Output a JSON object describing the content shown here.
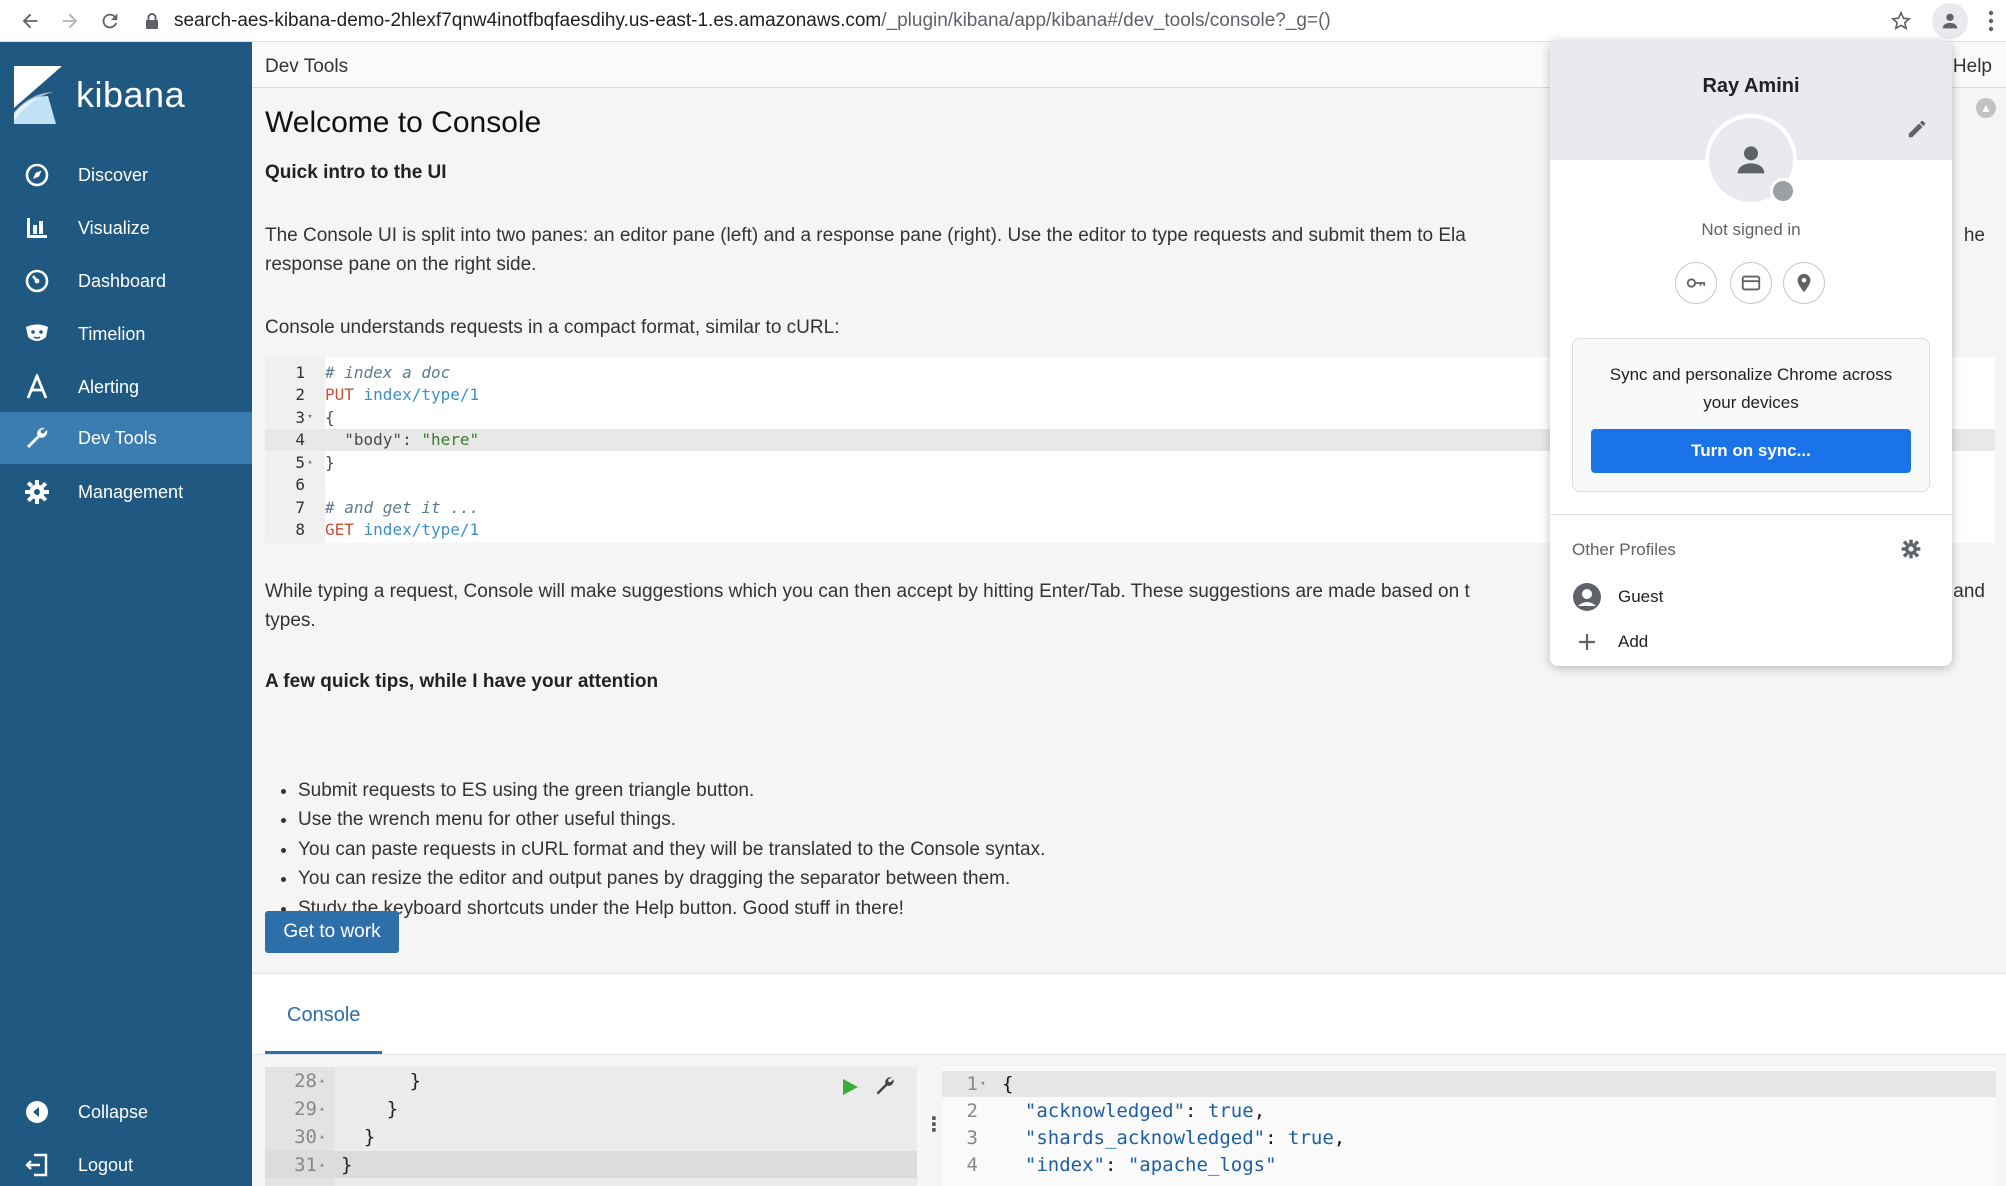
{
  "browser": {
    "url_domain": "search-aes-kibana-demo-2hlexf7qnw4inotfbqfaesdihy.us-east-1.es.amazonaws.com",
    "url_path": "/_plugin/kibana/app/kibana#/dev_tools/console?_g=()"
  },
  "sidebar": {
    "brand": "kibana",
    "items": [
      {
        "label": "Discover",
        "icon": "compass-icon"
      },
      {
        "label": "Visualize",
        "icon": "bar-chart-icon"
      },
      {
        "label": "Dashboard",
        "icon": "dashboard-icon"
      },
      {
        "label": "Timelion",
        "icon": "timelion-icon"
      },
      {
        "label": "Alerting",
        "icon": "alerting-icon"
      },
      {
        "label": "Dev Tools",
        "icon": "wrench-icon"
      },
      {
        "label": "Management",
        "icon": "gear-icon"
      }
    ],
    "collapse": "Collapse",
    "logout": "Logout"
  },
  "topbar": {
    "crumb": "Dev Tools",
    "help": "Help"
  },
  "welcome": {
    "title": "Welcome to Console",
    "intro_heading": "Quick intro to the UI",
    "intro_text": "The Console UI is split into two panes: an editor pane (left) and a response pane (right). Use the editor to type requests and submit them to Ela",
    "intro_text_tail": "he",
    "intro_text_line2": "response pane on the right side.",
    "curl_text": "Console understands requests in a compact format, similar to cURL:",
    "code_lines": [
      {
        "n": "1",
        "fold": "",
        "parts": [
          {
            "t": "# index a doc",
            "c": "c-comment"
          }
        ]
      },
      {
        "n": "2",
        "fold": "",
        "parts": [
          {
            "t": "PUT",
            "c": "c-method"
          },
          {
            "t": " index/type/1",
            "c": "c-url"
          }
        ]
      },
      {
        "n": "3",
        "fold": "▾",
        "parts": [
          {
            "t": "{",
            "c": "c-key"
          }
        ]
      },
      {
        "n": "4",
        "fold": "",
        "parts": [
          {
            "t": "  \"body\"",
            "c": "c-key"
          },
          {
            "t": ": ",
            "c": "c-key"
          },
          {
            "t": "\"here\"",
            "c": "c-str"
          }
        ]
      },
      {
        "n": "5",
        "fold": "▴",
        "parts": [
          {
            "t": "}",
            "c": "c-key"
          }
        ]
      },
      {
        "n": "6",
        "fold": "",
        "parts": []
      },
      {
        "n": "7",
        "fold": "",
        "parts": [
          {
            "t": "# and get it ...",
            "c": "c-comment"
          }
        ]
      },
      {
        "n": "8",
        "fold": "",
        "parts": [
          {
            "t": "GET",
            "c": "c-method"
          },
          {
            "t": " index/type/1",
            "c": "c-url"
          }
        ]
      }
    ],
    "suggest_text": "While typing a request, Console will make suggestions which you can then accept by hitting Enter/Tab. These suggestions are made based on t",
    "suggest_tail": "and",
    "suggest_line2": "types.",
    "tips_heading": "A few quick tips, while I have your attention",
    "tips": [
      "Submit requests to ES using the green triangle button.",
      "Use the wrench menu for other useful things.",
      "You can paste requests in cURL format and they will be translated to the Console syntax.",
      "You can resize the editor and output panes by dragging the separator between them.",
      "Study the keyboard shortcuts under the Help button. Good stuff in there!"
    ],
    "button": "Get to work"
  },
  "console": {
    "tab": "Console",
    "editor_lines": [
      {
        "n": "28",
        "fold": "▴",
        "code": "      }"
      },
      {
        "n": "29",
        "fold": "▴",
        "code": "    }"
      },
      {
        "n": "30",
        "fold": "▴",
        "code": "  }"
      },
      {
        "n": "31",
        "fold": "▴",
        "code": "}"
      }
    ],
    "output_lines": [
      {
        "n": "1",
        "fold": "▾",
        "parts": [
          {
            "t": "{",
            "c": ""
          }
        ]
      },
      {
        "n": "2",
        "fold": "",
        "parts": [
          {
            "t": "  \"acknowledged\"",
            "c": "o-key"
          },
          {
            "t": ": ",
            "c": ""
          },
          {
            "t": "true",
            "c": "o-bool"
          },
          {
            "t": ",",
            "c": ""
          }
        ]
      },
      {
        "n": "3",
        "fold": "",
        "parts": [
          {
            "t": "  \"shards_acknowledged\"",
            "c": "o-key"
          },
          {
            "t": ": ",
            "c": ""
          },
          {
            "t": "true",
            "c": "o-bool"
          },
          {
            "t": ",",
            "c": ""
          }
        ]
      },
      {
        "n": "4",
        "fold": "",
        "parts": [
          {
            "t": "  \"index\"",
            "c": "o-key"
          },
          {
            "t": ": ",
            "c": ""
          },
          {
            "t": "\"apache_logs\"",
            "c": "o-str"
          }
        ]
      }
    ]
  },
  "profile_popup": {
    "name": "Ray Amini",
    "status": "Not signed in",
    "sync_text_line1": "Sync and personalize Chrome across",
    "sync_text_line2": "your devices",
    "sync_button": "Turn on sync...",
    "other_profiles_label": "Other Profiles",
    "profiles": [
      {
        "label": "Guest",
        "icon": "guest-avatar-icon"
      },
      {
        "label": "Add",
        "icon": "plus-icon"
      }
    ]
  },
  "colors": {
    "sidebar_bg": "#1f5881",
    "sidebar_active": "#3b7cb1",
    "primary_button": "#2d6fa8",
    "sync_button": "#1a73e8"
  }
}
